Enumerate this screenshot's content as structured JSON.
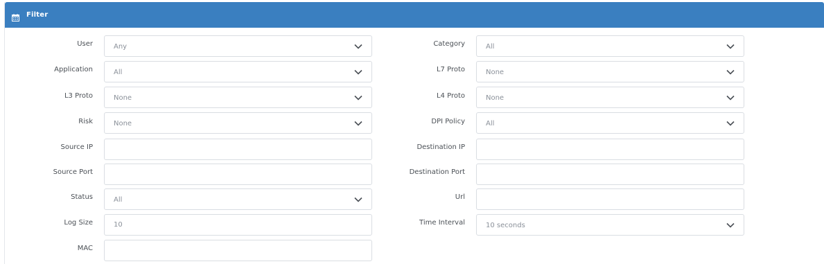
{
  "header": {
    "title": "Filter",
    "icon": "calendar-icon",
    "color": "#3a7fc0"
  },
  "filters": {
    "user": {
      "label": "User",
      "value": "Any"
    },
    "application": {
      "label": "Application",
      "value": "All"
    },
    "l3_proto": {
      "label": "L3 Proto",
      "value": "None"
    },
    "risk": {
      "label": "Risk",
      "value": "None"
    },
    "source_ip": {
      "label": "Source IP",
      "value": ""
    },
    "source_port": {
      "label": "Source Port",
      "value": ""
    },
    "status": {
      "label": "Status",
      "value": "All"
    },
    "log_size": {
      "label": "Log Size",
      "value": "10"
    },
    "mac": {
      "label": "MAC",
      "value": ""
    },
    "category": {
      "label": "Category",
      "value": "All"
    },
    "l7_proto": {
      "label": "L7 Proto",
      "value": "None"
    },
    "l4_proto": {
      "label": "L4 Proto",
      "value": "None"
    },
    "dpi_policy": {
      "label": "DPI Policy",
      "value": "All"
    },
    "destination_ip": {
      "label": "Destination IP",
      "value": ""
    },
    "destination_port": {
      "label": "Destination Port",
      "value": ""
    },
    "url": {
      "label": "Url",
      "value": ""
    },
    "time_interval": {
      "label": "Time Interval",
      "value": "10 seconds"
    }
  }
}
